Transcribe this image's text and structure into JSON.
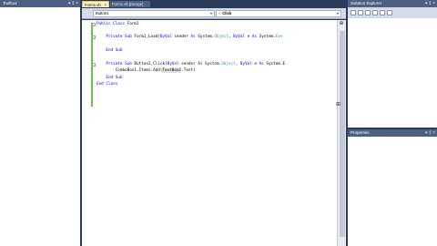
{
  "toolbox": {
    "title": "Toolbox",
    "icons": [
      "pin-icon",
      "close-icon"
    ]
  },
  "tabs": [
    {
      "label": "Form1.vb",
      "active": true
    },
    {
      "label": "Form1.vb [Design]",
      "active": false
    }
  ],
  "navbar": {
    "object_combo": "Button1",
    "event_combo": "Click"
  },
  "code": {
    "line1": {
      "kw": "Public Class",
      "rest": " Form1"
    },
    "line2": {
      "pre": "    ",
      "kw1": "Private Sub",
      "name": " Form1_Load(",
      "kw2": "ByVal",
      "p1": " sender ",
      "kw3": "As",
      "t1": " System.",
      "ty1": "Object",
      "p2": ", ",
      "kw4": "ByVal",
      "p3": " e ",
      "kw5": "As",
      "t2": " System.",
      "ty2": "Eve"
    },
    "line3": {
      "pre": "    ",
      "kw": "End Sub"
    },
    "line4": {
      "pre": "    ",
      "kw1": "Private Sub",
      "name": " Button1_Click(",
      "kw2": "ByVal",
      "p1": " sender ",
      "kw3": "As",
      "t1": " System.",
      "ty1": "Object",
      "p2": ", ",
      "kw4": "ByVal",
      "p3": " e ",
      "kw5": "As",
      "t2": " System.E"
    },
    "line5": {
      "pre": "        ComboBox1.Items.Add(",
      "hl": "TextBox1",
      "post": ".Text)"
    },
    "line6": {
      "pre": "    ",
      "kw": "End Sub"
    },
    "line7": {
      "kw": "End Class"
    }
  },
  "solution_explorer": {
    "title": "Solution Explorer",
    "icons": [
      "pin-icon",
      "close-icon"
    ]
  },
  "properties": {
    "title": "Properties",
    "icons": [
      "pin-icon",
      "close-icon"
    ]
  },
  "colors": {
    "panel_title": "#4d6082",
    "chrome": "#2b3c59",
    "keyword": "#0000ff",
    "type": "#2b91af",
    "change_bar": "#6dc048"
  }
}
